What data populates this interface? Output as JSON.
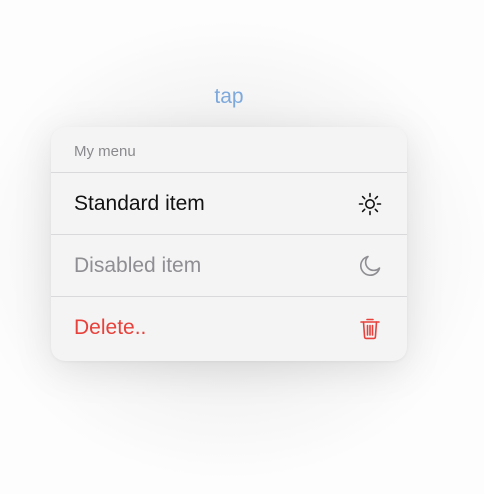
{
  "trigger": {
    "label": "tap"
  },
  "menu": {
    "title": "My menu",
    "items": [
      {
        "label": "Standard item",
        "icon": "sun-icon",
        "state": "enabled"
      },
      {
        "label": "Disabled item",
        "icon": "moon-icon",
        "state": "disabled"
      },
      {
        "label": "Delete..",
        "icon": "trash-icon",
        "state": "destructive"
      }
    ]
  },
  "colors": {
    "accent": "#7ea9dd",
    "destructive": "#e8403a",
    "disabled": "#8e8e93",
    "text": "#111111"
  }
}
